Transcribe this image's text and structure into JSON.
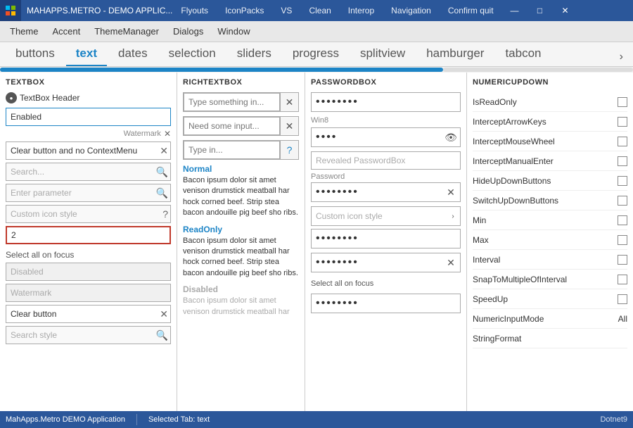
{
  "titlebar": {
    "app_name": "MAHAPPS.METRO - DEMO APPLIC...",
    "nav_items": [
      "Flyouts",
      "IconPacks",
      "VS",
      "Clean",
      "Interop",
      "Navigation",
      "Confirm quit"
    ],
    "win_controls": [
      "—",
      "□",
      "✕"
    ]
  },
  "menubar": {
    "items": [
      "Theme",
      "Accent",
      "ThemeManager",
      "Dialogs",
      "Window"
    ]
  },
  "tabs": {
    "items": [
      "buttons",
      "text",
      "dates",
      "selection",
      "sliders",
      "progress",
      "splitview",
      "hamburger",
      "tabcon"
    ],
    "active": "text"
  },
  "textbox": {
    "header": "TEXTBOX",
    "header_label": "TextBox Header",
    "enabled_value": "Enabled",
    "watermark_label": "Watermark",
    "clear_no_ctx": "Clear button and no ContextMenu",
    "search_placeholder": "Search...",
    "enter_param": "Enter parameter",
    "custom_icon": "Custom icon style",
    "red_value": "2",
    "select_all_focus": "Select all on focus",
    "disabled_label": "Disabled",
    "watermark_lower": "Watermark",
    "clear_btn": "Clear button",
    "search_style": "Search style"
  },
  "richtextbox": {
    "header": "RICHTEXTBOX",
    "placeholder1": "Type something in...",
    "placeholder2": "Need some input...",
    "placeholder3": "Type in...",
    "normal_title": "Normal",
    "normal_text": "Bacon ipsum dolor sit amet venison drumstick meatball har hock corned beef. Strip stea bacon andouille pig beef sho ribs.",
    "readonly_title": "ReadOnly",
    "readonly_text": "Bacon ipsum dolor sit amet venison drumstick meatball har hock corned beef. Strip stea bacon andouille pig beef sho ribs.",
    "disabled_title": "Disabled",
    "disabled_text": "Bacon ipsum dolor sit amet venison drumstick meatball har"
  },
  "passwordbox": {
    "header": "PASSWORDBOX",
    "dots1": "••••••••",
    "win8_label": "Win8",
    "dots2": "••••",
    "revealed_label": "Revealed PasswordBox",
    "password_label": "Password",
    "dots3": "••••••••",
    "custom_label": "Custom icon style",
    "dots4": "••••••••",
    "dots5": "••••••••",
    "select_all": "Select all on focus",
    "dots6": "••••••••"
  },
  "numericupdown": {
    "header": "NUMERICUPDOWN",
    "rows": [
      {
        "label": "IsReadOnly",
        "type": "checkbox"
      },
      {
        "label": "InterceptArrowKeys",
        "type": "checkbox"
      },
      {
        "label": "InterceptMouseWheel",
        "type": "checkbox"
      },
      {
        "label": "InterceptManualEnter",
        "type": "checkbox"
      },
      {
        "label": "HideUpDownButtons",
        "type": "checkbox"
      },
      {
        "label": "SwitchUpDownButtons",
        "type": "checkbox"
      },
      {
        "label": "Min",
        "type": "checkbox"
      },
      {
        "label": "Max",
        "type": "checkbox"
      },
      {
        "label": "Interval",
        "type": "checkbox"
      },
      {
        "label": "SnapToMultipleOfInterval",
        "type": "checkbox"
      },
      {
        "label": "SpeedUp",
        "type": "checkbox"
      },
      {
        "label": "NumericInputMode",
        "type": "value",
        "value": "All"
      },
      {
        "label": "StringFormat",
        "type": "none"
      }
    ]
  },
  "statusbar": {
    "app_label": "MahApps.Metro DEMO Application",
    "selected_tab": "Selected Tab:  text",
    "dotnet_logo": "Dotnet9"
  }
}
